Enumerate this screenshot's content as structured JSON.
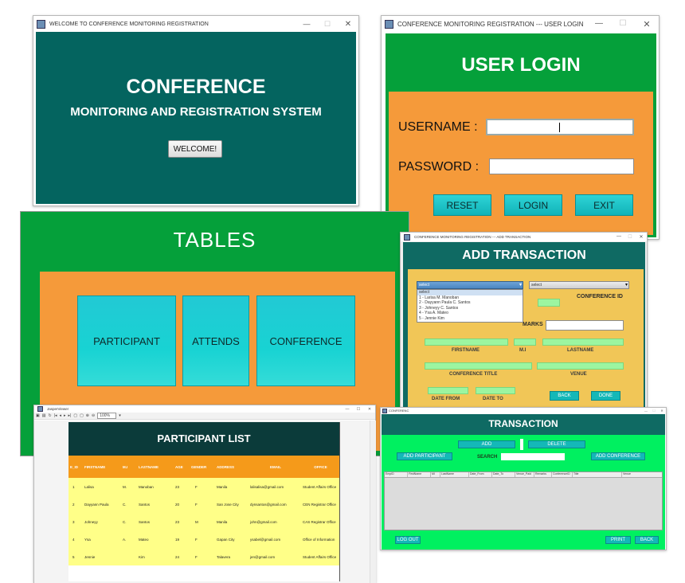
{
  "welcome": {
    "window_title": "WELCOME TO CONFERENCE MONITORING REGISTRATION",
    "heading": "CONFERENCE",
    "subheading": "MONITORING AND REGISTRATION SYSTEM",
    "welcome_button": "WELCOME!",
    "bg_color": "#04645f"
  },
  "login": {
    "window_title": "CONFERENCE MONITORING REGISTRATION --- USER LOGIN",
    "heading": "USER LOGIN",
    "username_label": "USERNAME :",
    "password_label": "PASSWORD :",
    "username_value": "",
    "password_value": "",
    "reset_button": "RESET",
    "login_button": "LOGIN",
    "exit_button": "EXIT"
  },
  "tables": {
    "heading": "TABLES",
    "participant_button": "PARTICIPANT",
    "attends_button": "ATTENDS",
    "conference_button": "CONFERENCE"
  },
  "add_transaction": {
    "window_title": "CONFERENCE MONITORING REGISTRATION --- ADD TRANSACTION",
    "heading": "ADD TRANSACTION",
    "participant_select": "select",
    "participant_options": [
      "select",
      "1 - Larisa M. Manoban",
      "2 - Dayyann Paula C. Santos",
      "3 - Johneyy C. Santos",
      "4 - Ysa A. Mateo",
      "5 - Jennie Kim"
    ],
    "conference_select": "select",
    "conference_id_label": "CONFERENCE ID",
    "remarks_label": "MARKS",
    "firstname_label": "FIRSTNAME",
    "mi_label": "M.I",
    "lastname_label": "LASTNAME",
    "conference_title_label": "CONFERENCE TITLE",
    "venue_label": "VENUE",
    "date_from_label": "DATE FROM",
    "date_to_label": "DATE TO",
    "back_button": "BACK",
    "done_button": "DONE"
  },
  "report": {
    "window_title": "JasperViewer",
    "zoom": "100%",
    "heading": "PARTICIPANT LIST",
    "columns": [
      "E_ID",
      "FIRSTNAME",
      "M.I",
      "LASTNAME",
      "AGE",
      "GENDER",
      "ADDRESS",
      "EMAIL",
      "OFFICE"
    ],
    "rows": [
      [
        "1",
        "Lalisa",
        "M.",
        "Manoban",
        "23",
        "F",
        "Manila",
        "lalisalisa@gmail.com",
        "Student Affairs Office"
      ],
      [
        "2",
        "Dayyann Paula",
        "C.",
        "Santos",
        "20",
        "F",
        "San Jose City",
        "dynsantos@gmail.com",
        "CEN Registrar Office"
      ],
      [
        "3",
        "Johneyy",
        "C.",
        "Santos",
        "23",
        "M",
        "Manila",
        "john@gmail.com",
        "CAS Registrar Office"
      ],
      [
        "4",
        "Ysa",
        "A.",
        "Mateo",
        "19",
        "F",
        "Gapan City",
        "ysabel@gmail.com",
        "Office of Information"
      ],
      [
        "5",
        "Jennie",
        "",
        "Kim",
        "24",
        "F",
        "Talavera",
        "jen@gmail.com",
        "Student Affairs Office"
      ]
    ]
  },
  "transaction": {
    "window_title": "CONFERENC",
    "heading": "TRANSACTION",
    "add_button": "ADD",
    "delete_button": "DELETE",
    "add_participant_button": "ADD PARTICIPANT",
    "search_label": "SEARCH",
    "search_value": "",
    "add_conference_button": "ADD CONFERENCE",
    "columns": [
      "EmpID",
      "FirstName",
      "MI",
      "LastName",
      "Date_From",
      "Date_To",
      "Venue_Paid",
      "Remarks",
      "ConferenceID",
      "Title",
      "Venue"
    ],
    "logout_button": "LOG OUT",
    "print_button": "PRINT",
    "back_button": "BACK"
  }
}
